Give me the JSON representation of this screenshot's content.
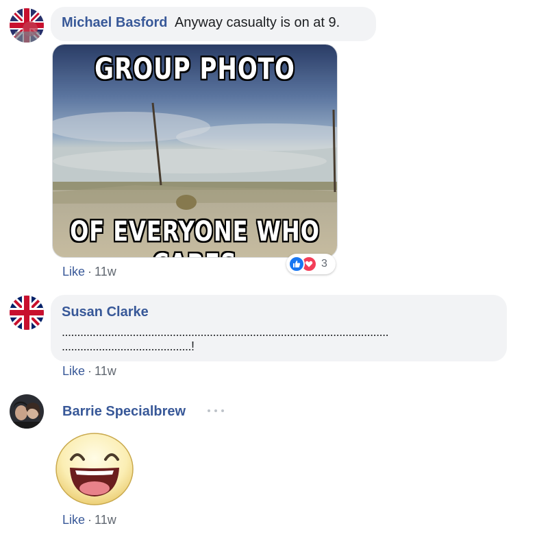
{
  "comments": [
    {
      "author": "Michael Basford",
      "text": "Anyway casualty is on at 9.",
      "photo": {
        "top_text": "GROUP PHOTO",
        "bottom_text": "OF EVERYONE WHO CARES"
      },
      "reactions": {
        "icons": [
          "like-icon",
          "love-icon"
        ],
        "count": "3"
      },
      "actions": {
        "like": "Like",
        "sep": "·",
        "time": "11w"
      }
    },
    {
      "author": "Susan Clarke",
      "text_line1": "..........................................................................................................",
      "text_line2": "..........................................!",
      "actions": {
        "like": "Like",
        "sep": "·",
        "time": "11w"
      }
    },
    {
      "author": "Barrie Specialbrew",
      "sticker": "laughing-face-sticker",
      "actions": {
        "like": "Like",
        "sep": "·",
        "time": "11w"
      }
    }
  ],
  "colors": {
    "author": "#385898",
    "bubble": "#f2f3f5",
    "like_blue": "#1877f2",
    "love_red": "#f33e58"
  }
}
